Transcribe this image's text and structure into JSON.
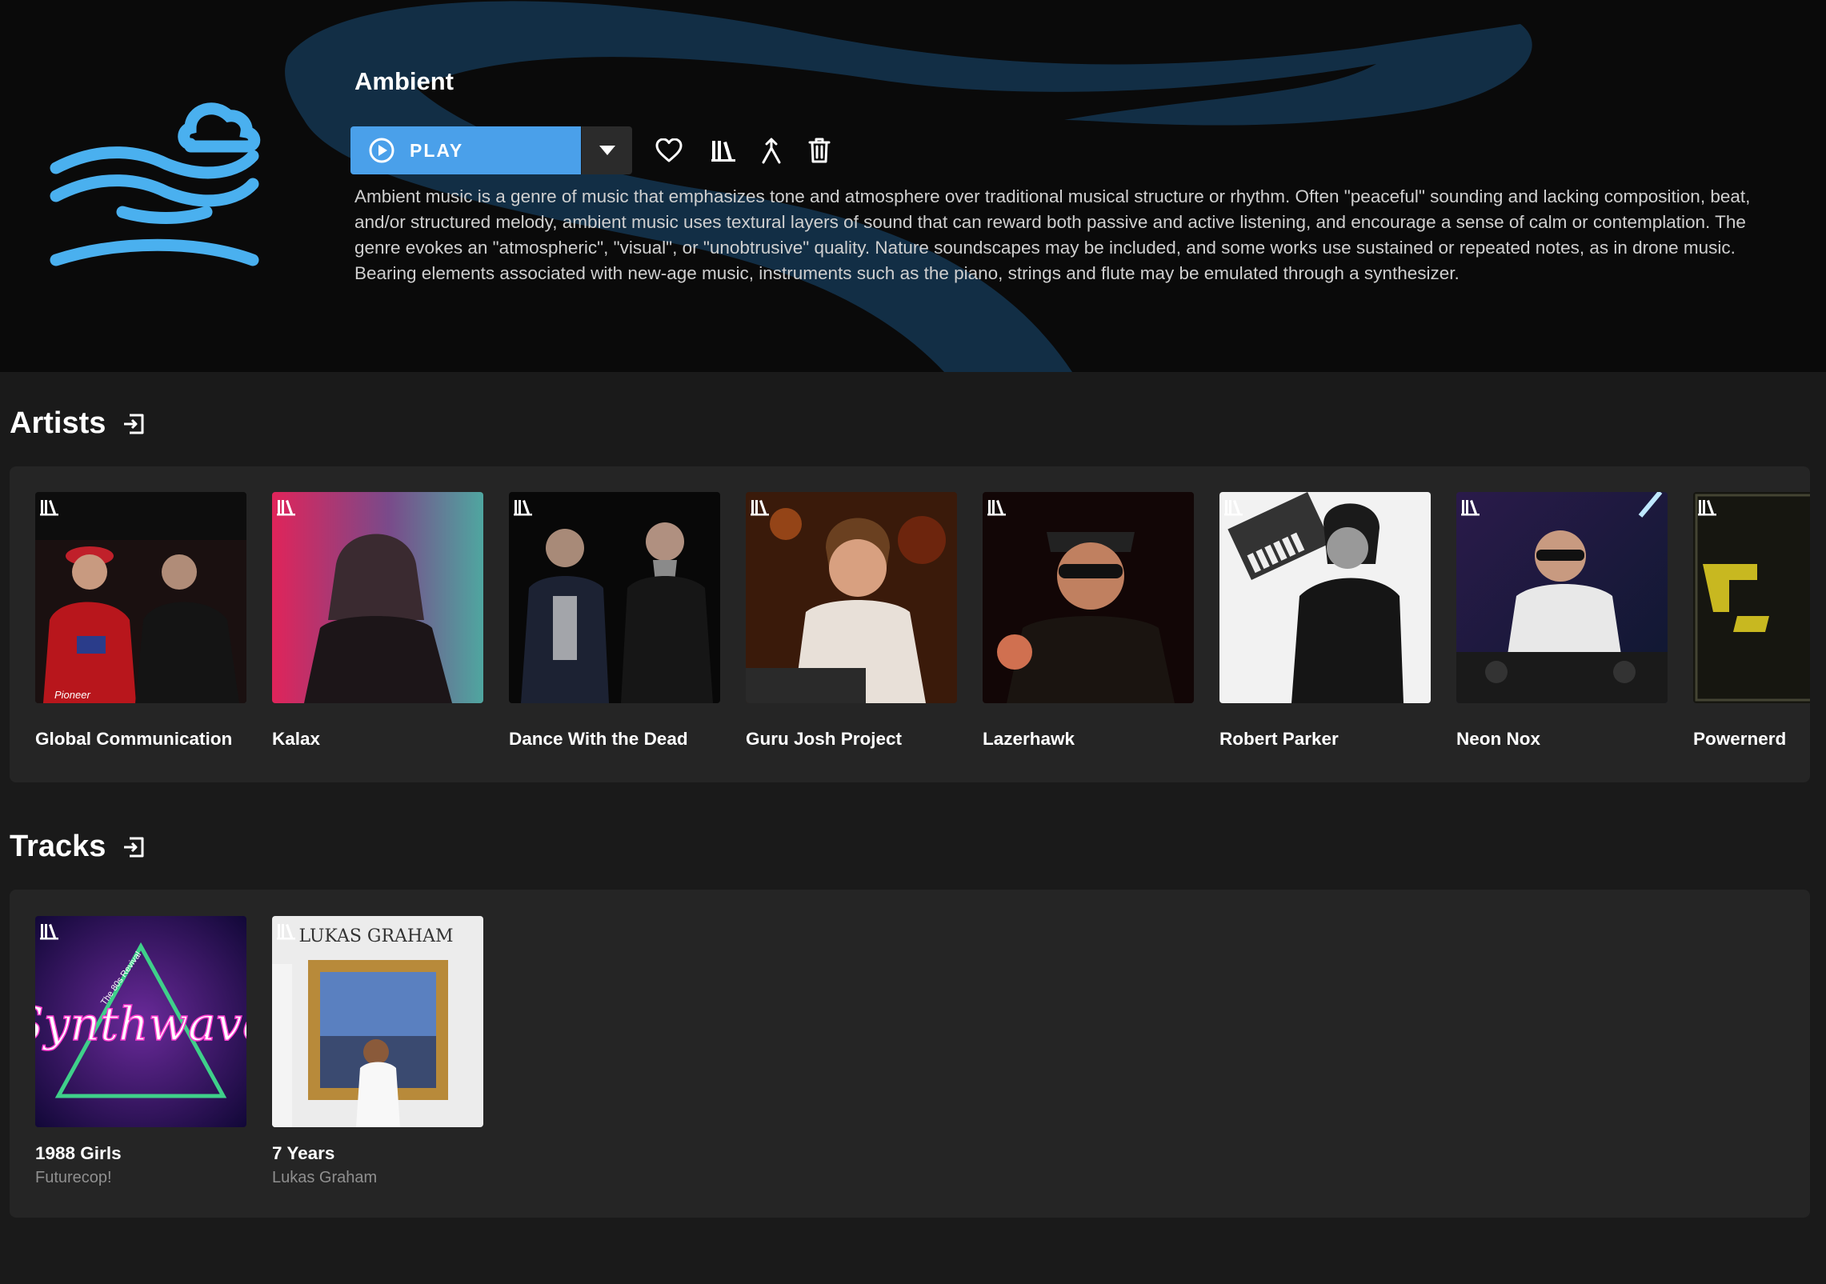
{
  "genre": {
    "title": "Ambient",
    "play_label": "PLAY",
    "description": "Ambient music is a genre of music that emphasizes tone and atmosphere over traditional musical structure or rhythm. Often \"peaceful\" sounding and lacking composition, beat, and/or structured melody, ambient music uses textural layers of sound that can reward both passive and active listening, and encourage a sense of calm or contemplation. The genre evokes an \"atmospheric\", \"visual\", or \"unobtrusive\" quality. Nature soundscapes may be included, and some works use sustained or repeated notes, as in drone music. Bearing elements associated with new-age music, instruments such as the piano, strings and flute may be emulated through a synthesizer.",
    "accent_color": "#4aa0ea",
    "actions": [
      "heart-icon",
      "library-icon",
      "merge-icon",
      "trash-icon"
    ]
  },
  "artists": {
    "title": "Artists",
    "items": [
      {
        "name": "Global Communication"
      },
      {
        "name": "Kalax"
      },
      {
        "name": "Dance With the Dead"
      },
      {
        "name": "Guru Josh Project"
      },
      {
        "name": "Lazerhawk"
      },
      {
        "name": "Robert Parker"
      },
      {
        "name": "Neon Nox"
      },
      {
        "name": "Powernerd"
      }
    ]
  },
  "tracks": {
    "title": "Tracks",
    "items": [
      {
        "name": "1988 Girls",
        "artist": "Futurecop!",
        "cover_text": "Synthwave",
        "cover_subtext": "The 80s Revival"
      },
      {
        "name": "7 Years",
        "artist": "Lukas Graham",
        "cover_text": "LUKAS GRAHAM"
      }
    ]
  }
}
